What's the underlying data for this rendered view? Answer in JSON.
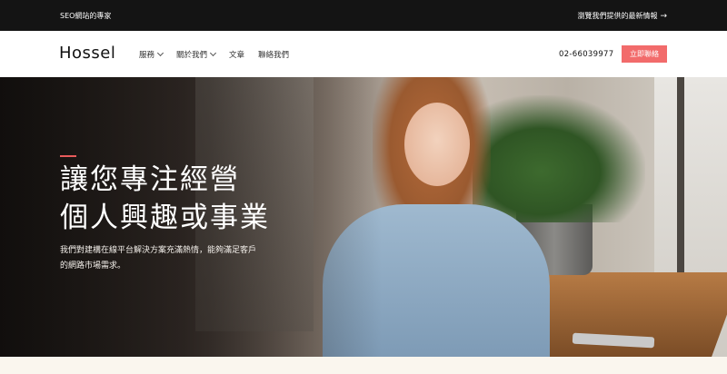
{
  "topbar": {
    "tagline": "SEO網站的專家",
    "news_link": "瀏覽我們提供的最新情報",
    "news_arrow": "→"
  },
  "nav": {
    "logo": "Hossel",
    "menu": [
      {
        "label": "服務",
        "dropdown": true
      },
      {
        "label": "關於我們",
        "dropdown": true
      },
      {
        "label": "文章",
        "dropdown": false
      },
      {
        "label": "聯絡我們",
        "dropdown": false
      }
    ],
    "phone": "02-66039977",
    "cta_label": "立即聯絡"
  },
  "hero": {
    "headline_line1": "讓您專注經營",
    "headline_line2": "個人興趣或事業",
    "sub_line1": "我們對建構在線平台解決方案充滿熱情，能夠滿足客戶",
    "sub_line2": "的網路市場需求。"
  },
  "colors": {
    "topbar_bg": "#141414",
    "accent": "#f26b6b"
  }
}
